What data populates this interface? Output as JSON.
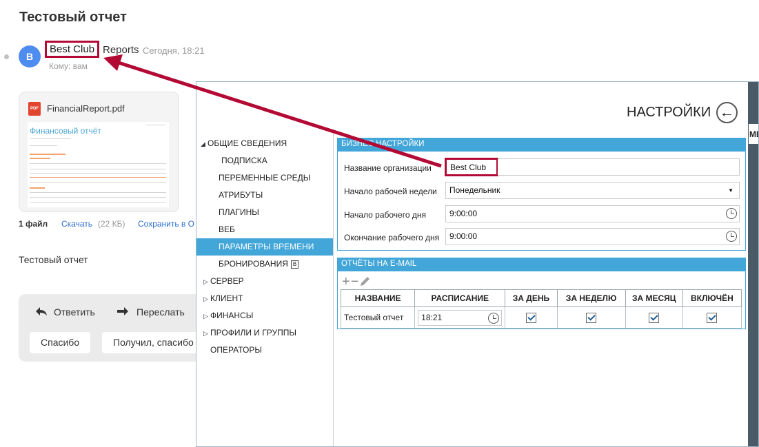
{
  "mail": {
    "subject": "Тестовый отчет",
    "avatar_letter": "B",
    "sender_highlighted": "Best Club",
    "sender_rest": "Reports",
    "time": "Сегодня, 18:21",
    "recipient": "Кому: вам",
    "attachment": {
      "file_name": "FinancialReport.pdf",
      "icon": "pdf-file-icon",
      "icon_label": "PDF",
      "thumb_title": "Финансовый отчёт"
    },
    "files_count": "1 файл",
    "download_label": "Скачать",
    "download_size": "(22 КБ)",
    "save_label": "Сохранить в О",
    "body": "Тестовый отчет",
    "reply_label": "Ответить",
    "forward_label": "Переслать",
    "quick_replies": [
      "Спасибо",
      "Получил, спасибо"
    ]
  },
  "annotation": {
    "color": "#b30a35"
  },
  "settings": {
    "title": "НАСТРОЙКИ",
    "back_icon": "arrow-left-icon",
    "nav": [
      {
        "label": "ОБЩИЕ СВЕДЕНИЯ",
        "expanded": true,
        "level": 0
      },
      {
        "label": "ПОДПИСКА",
        "level": 1
      },
      {
        "label": "ПЕРЕМЕННЫЕ СРЕДЫ",
        "level": 1
      },
      {
        "label": "АТРИБУТЫ",
        "level": 1
      },
      {
        "label": "ПЛАГИНЫ",
        "level": 1
      },
      {
        "label": "ВЕБ",
        "level": 1
      },
      {
        "label": "ПАРАМЕТРЫ ВРЕМЕНИ",
        "level": 1,
        "selected": true
      },
      {
        "label": "БРОНИРОВАНИЯ",
        "level": 1,
        "badge": "B"
      },
      {
        "label": "СЕРВЕР",
        "level": 0,
        "collapsed": true
      },
      {
        "label": "КЛИЕНТ",
        "level": 0,
        "collapsed": true
      },
      {
        "label": "ФИНАНСЫ",
        "level": 0,
        "collapsed": true
      },
      {
        "label": "ПРОФИЛИ И ГРУППЫ",
        "level": 0,
        "collapsed": true
      },
      {
        "label": "ОПЕРАТОРЫ",
        "level": 0
      }
    ],
    "business": {
      "header": "БИЗНЕС НАСТРОЙКИ",
      "org_label": "Название организации",
      "org_value": "Best Club",
      "week_start_label": "Начало рабочей недели",
      "week_start_value": "Понедельник",
      "day_start_label": "Начало рабочего дня",
      "day_start_value": "9:00:00",
      "day_end_label": "Окончание рабочего дня",
      "day_end_value": "9:00:00"
    },
    "email_reports": {
      "header": "ОТЧЁТЫ НА E-MAIL",
      "columns": [
        "НАЗВАНИЕ",
        "РАСПИСАНИЕ",
        "ЗА ДЕНЬ",
        "ЗА НЕДЕЛЮ",
        "ЗА МЕСЯЦ",
        "ВКЛЮЧЁН"
      ],
      "rows": [
        {
          "name": "Тестовый отчет",
          "schedule": "18:21",
          "day": true,
          "week": true,
          "month": true,
          "enabled": true
        }
      ]
    },
    "right_edge_text": "МЕ"
  }
}
